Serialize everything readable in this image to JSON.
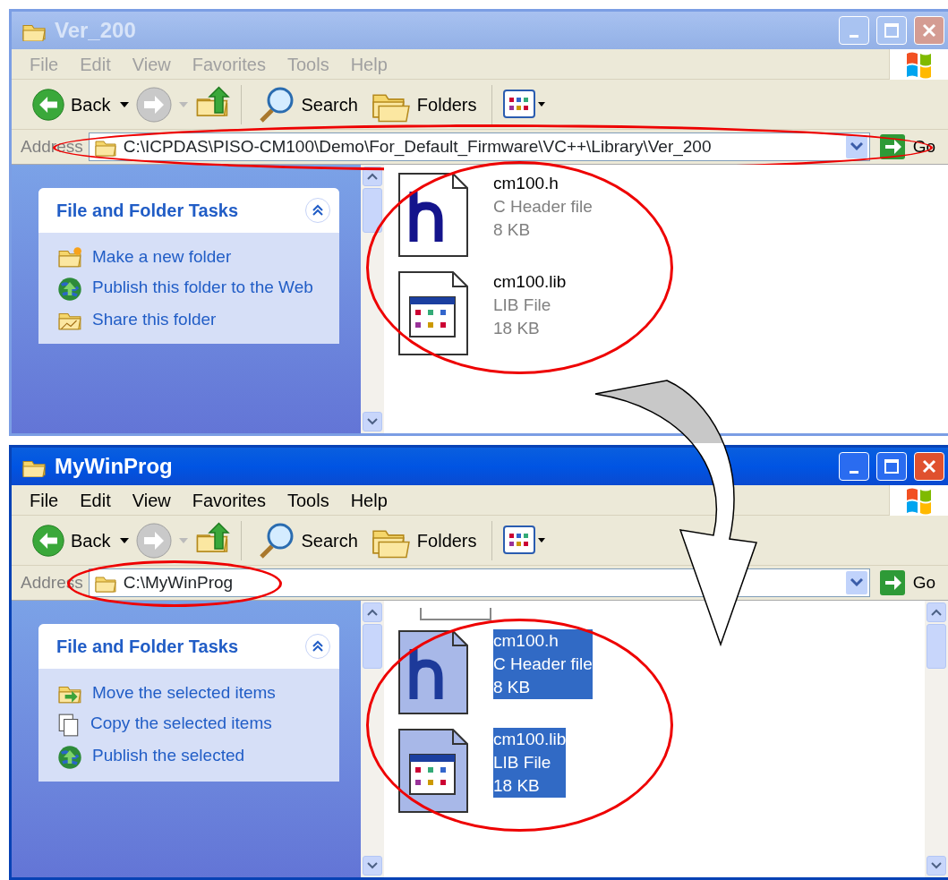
{
  "windows": [
    {
      "title": "Ver_200",
      "active": false,
      "menu": [
        "File",
        "Edit",
        "View",
        "Favorites",
        "Tools",
        "Help"
      ],
      "toolbar": {
        "back": "Back",
        "search": "Search",
        "folders": "Folders"
      },
      "address": {
        "label": "Address",
        "path": "C:\\ICPDAS\\PISO-CM100\\Demo\\For_Default_Firmware\\VC++\\Library\\Ver_200",
        "go": "Go",
        "circled": true
      },
      "tasks": {
        "title": "File and Folder Tasks",
        "items": [
          {
            "kind": "new-folder",
            "label": "Make a new folder"
          },
          {
            "kind": "publish",
            "label": "Publish this folder to the Web"
          },
          {
            "kind": "share",
            "label": "Share this folder"
          }
        ]
      },
      "files_circled": true,
      "files": [
        {
          "kind": "header",
          "name": "cm100.h",
          "type": "C Header file",
          "size": "8 KB",
          "selected": false
        },
        {
          "kind": "lib",
          "name": "cm100.lib",
          "type": "LIB File",
          "size": "18 KB",
          "selected": false
        }
      ]
    },
    {
      "title": "MyWinProg",
      "active": true,
      "menu": [
        "File",
        "Edit",
        "View",
        "Favorites",
        "Tools",
        "Help"
      ],
      "toolbar": {
        "back": "Back",
        "search": "Search",
        "folders": "Folders"
      },
      "address": {
        "label": "Address",
        "path": "C:\\MyWinProg",
        "go": "Go",
        "circled": true
      },
      "tasks": {
        "title": "File and Folder Tasks",
        "items": [
          {
            "kind": "move",
            "label": "Move the selected items"
          },
          {
            "kind": "copy",
            "label": "Copy the selected items"
          },
          {
            "kind": "publish",
            "label": "Publish the selected"
          }
        ]
      },
      "files_circled": true,
      "right_scrollbar": true,
      "cut_item_above": true,
      "files": [
        {
          "kind": "header",
          "name": "cm100.h",
          "type": "C Header file",
          "size": "8 KB",
          "selected": true
        },
        {
          "kind": "lib",
          "name": "cm100.lib",
          "type": "LIB File",
          "size": "18 KB",
          "selected": true
        }
      ]
    }
  ]
}
